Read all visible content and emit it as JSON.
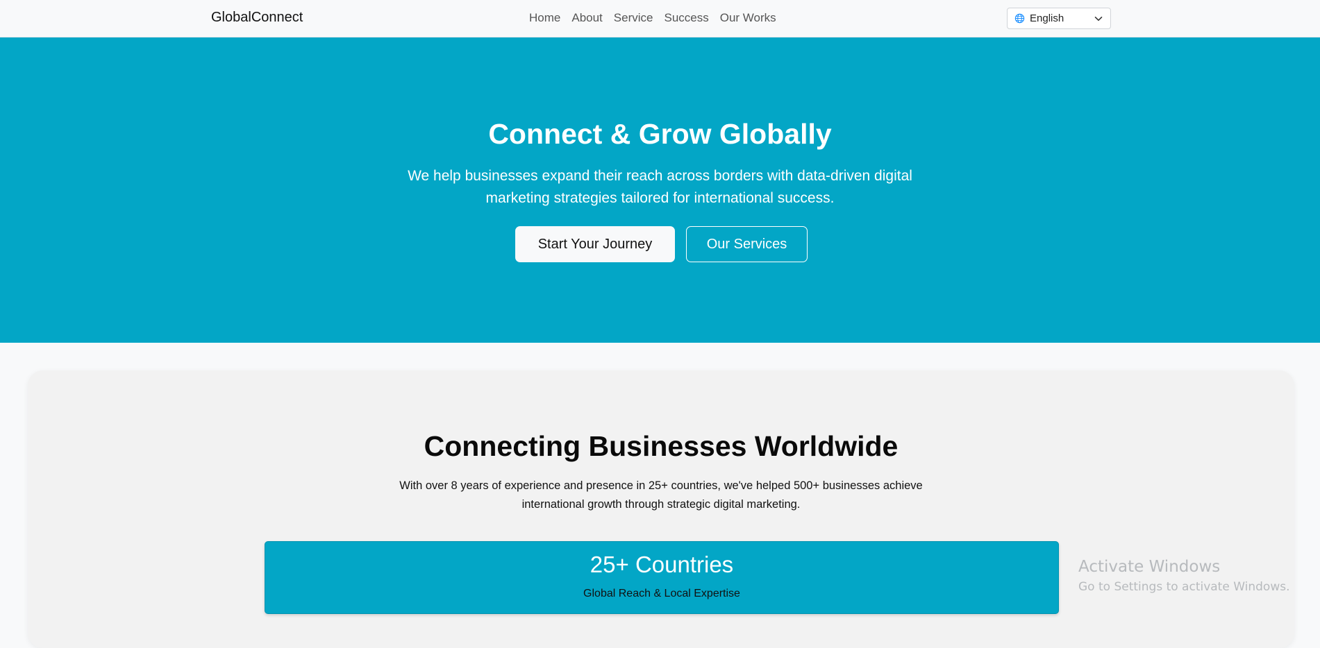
{
  "nav": {
    "brand": "GlobalConnect",
    "links": [
      {
        "label": "Home"
      },
      {
        "label": "About"
      },
      {
        "label": "Service"
      },
      {
        "label": "Success"
      },
      {
        "label": "Our Works"
      }
    ],
    "language": {
      "selected": "English",
      "icon": "globe-icon"
    }
  },
  "hero": {
    "title": "Connect & Grow Globally",
    "subtitle": "We help businesses expand their reach across borders with data-driven digital marketing strategies tailored for international success.",
    "primary_button": "Start Your Journey",
    "secondary_button": "Our Services"
  },
  "about": {
    "title": "Connecting Businesses Worldwide",
    "text": "With over 8 years of experience and presence in 25+ countries, we've helped 500+ businesses achieve international growth through strategic digital marketing.",
    "stat": {
      "value": "25+ Countries",
      "label": "Global Reach & Local Expertise"
    }
  },
  "watermark": {
    "title": "Activate Windows",
    "subtitle": "Go to Settings to activate Windows."
  },
  "colors": {
    "accent": "#03a6c6",
    "page_background": "#f8f9fa",
    "card_background": "#f2f2f2"
  }
}
